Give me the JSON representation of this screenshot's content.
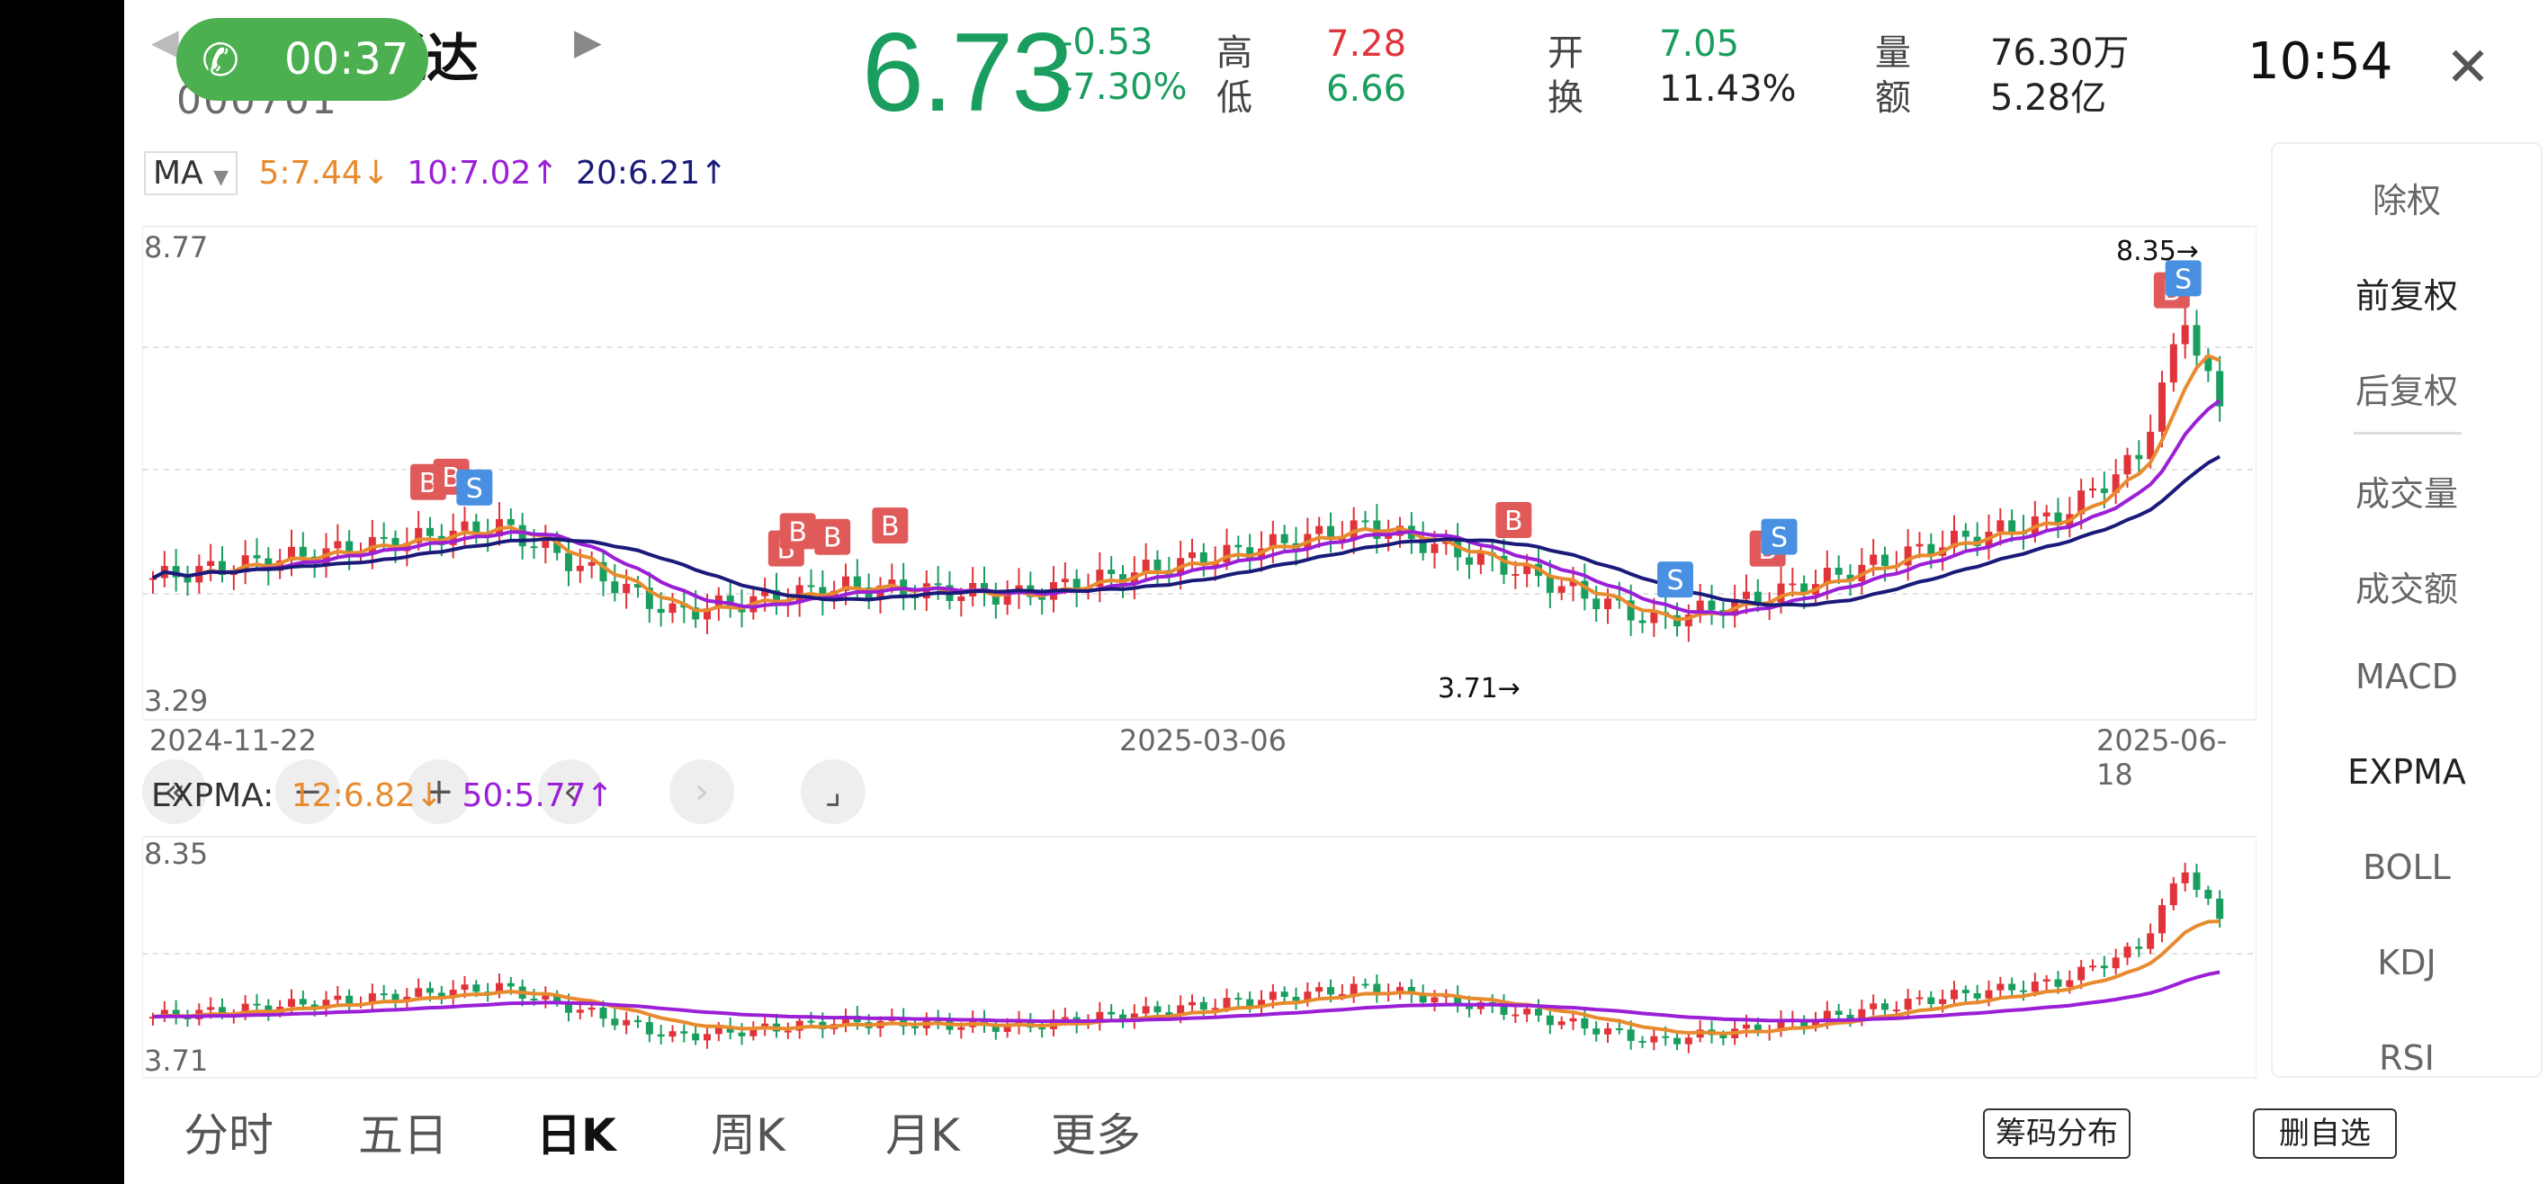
{
  "header": {
    "stock_name": "鼎通达",
    "stock_code": "000701",
    "call_timer": "00:37",
    "price": "6.73",
    "change": "-0.53",
    "change_pct": "-7.30%",
    "high_label": "高",
    "high": "7.28",
    "low_label": "低",
    "low": "6.66",
    "open_label": "开",
    "open": "7.05",
    "turnover_label": "换",
    "turnover": "11.43%",
    "volume_label": "量",
    "volume": "76.30万",
    "amount_label": "额",
    "amount": "5.28亿",
    "clock": "10:54"
  },
  "ma": {
    "selector": "MA",
    "ma5": "5:7.44",
    "ma10": "10:7.02",
    "ma20": "20:6.21"
  },
  "main_chart": {
    "y_top": "8.77",
    "y_bottom": "3.29",
    "high_mark": "8.35",
    "low_mark": "3.71",
    "dates": [
      "2024-11-22",
      "2025-03-06",
      "2025-06-18"
    ]
  },
  "expma": {
    "label": "EXPMA:",
    "ema12": "12:6.82",
    "ema50": "50:5.77",
    "y_top": "8.35",
    "y_bottom": "3.71"
  },
  "side_menu": [
    "除权",
    "前复权",
    "后复权",
    "成交量",
    "成交额",
    "MACD",
    "EXPMA",
    "BOLL",
    "KDJ",
    "RSI"
  ],
  "tabs": [
    "分时",
    "五日",
    "日K",
    "周K",
    "月K",
    "更多"
  ],
  "buttons": {
    "chips": "筹码分布",
    "remove_fav": "删自选"
  },
  "signals": {
    "buy": "B",
    "sell": "S"
  },
  "colors": {
    "up": "#e0343a",
    "down": "#1a9e5f",
    "ma5": "#e88a2e",
    "ma10": "#9b1fd6",
    "ma20": "#1a1a7a",
    "buy": "#e05a5a",
    "sell": "#4a90e2"
  },
  "chart_data": {
    "type": "candlestick",
    "series": [
      {
        "name": "5",
        "values": []
      },
      {
        "name": "10",
        "values": []
      },
      {
        "name": "20",
        "values": []
      }
    ]
  }
}
